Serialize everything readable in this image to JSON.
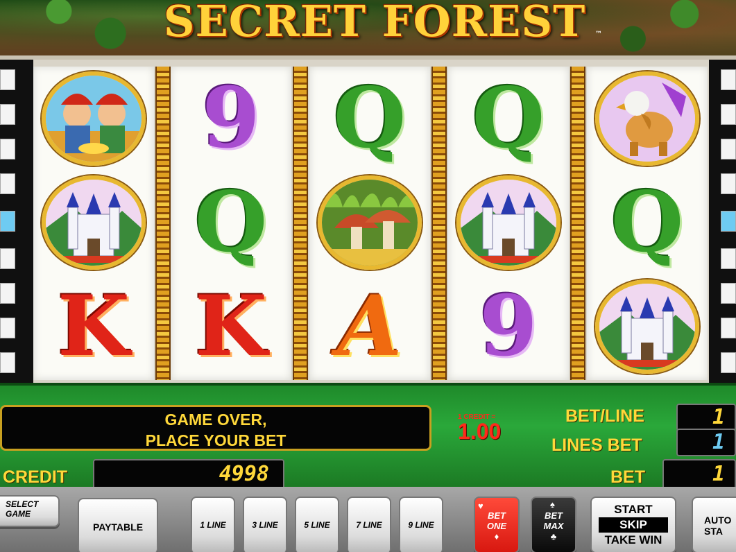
{
  "title": "SECRET FOREST",
  "trademark": "™",
  "reels": [
    [
      "gnomes",
      "castle",
      "K"
    ],
    [
      "9",
      "Q",
      "K"
    ],
    [
      "Q",
      "mushrooms",
      "A"
    ],
    [
      "Q",
      "castle",
      "9"
    ],
    [
      "griffin",
      "Q",
      "castle"
    ]
  ],
  "panel": {
    "message_line1": "GAME OVER,",
    "message_line2": "PLACE YOUR BET",
    "credit_eq": "1 CREDIT =",
    "credit_value": "1.00",
    "bet_line_label": "BET/LINE",
    "bet_line_value": "1",
    "lines_bet_label": "LINES BET",
    "lines_bet_value": "1",
    "credit_label": "CREDIT",
    "credit_amount": "4998",
    "bet_label": "BET",
    "bet_value": "1"
  },
  "buttons": {
    "select_game_1": "SELECT",
    "select_game_2": "GAME",
    "paytable": "PAYTABLE",
    "line1": "1 LINE",
    "line3": "3 LINE",
    "line5": "5 LINE",
    "line7": "7 LINE",
    "line9": "9 LINE",
    "bet_one_1": "BET",
    "bet_one_2": "ONE",
    "bet_max_1": "BET",
    "bet_max_2": "MAX",
    "start_1": "START",
    "start_2": "SKIP",
    "start_3": "TAKE WIN",
    "auto_1": "AUTO",
    "auto_2": "STA"
  },
  "colors": {
    "gold_text": "#ffd83a",
    "credit_red": "#ff2a1a",
    "lines_blue": "#6ecbf2",
    "console_green": "#2aa83a"
  }
}
